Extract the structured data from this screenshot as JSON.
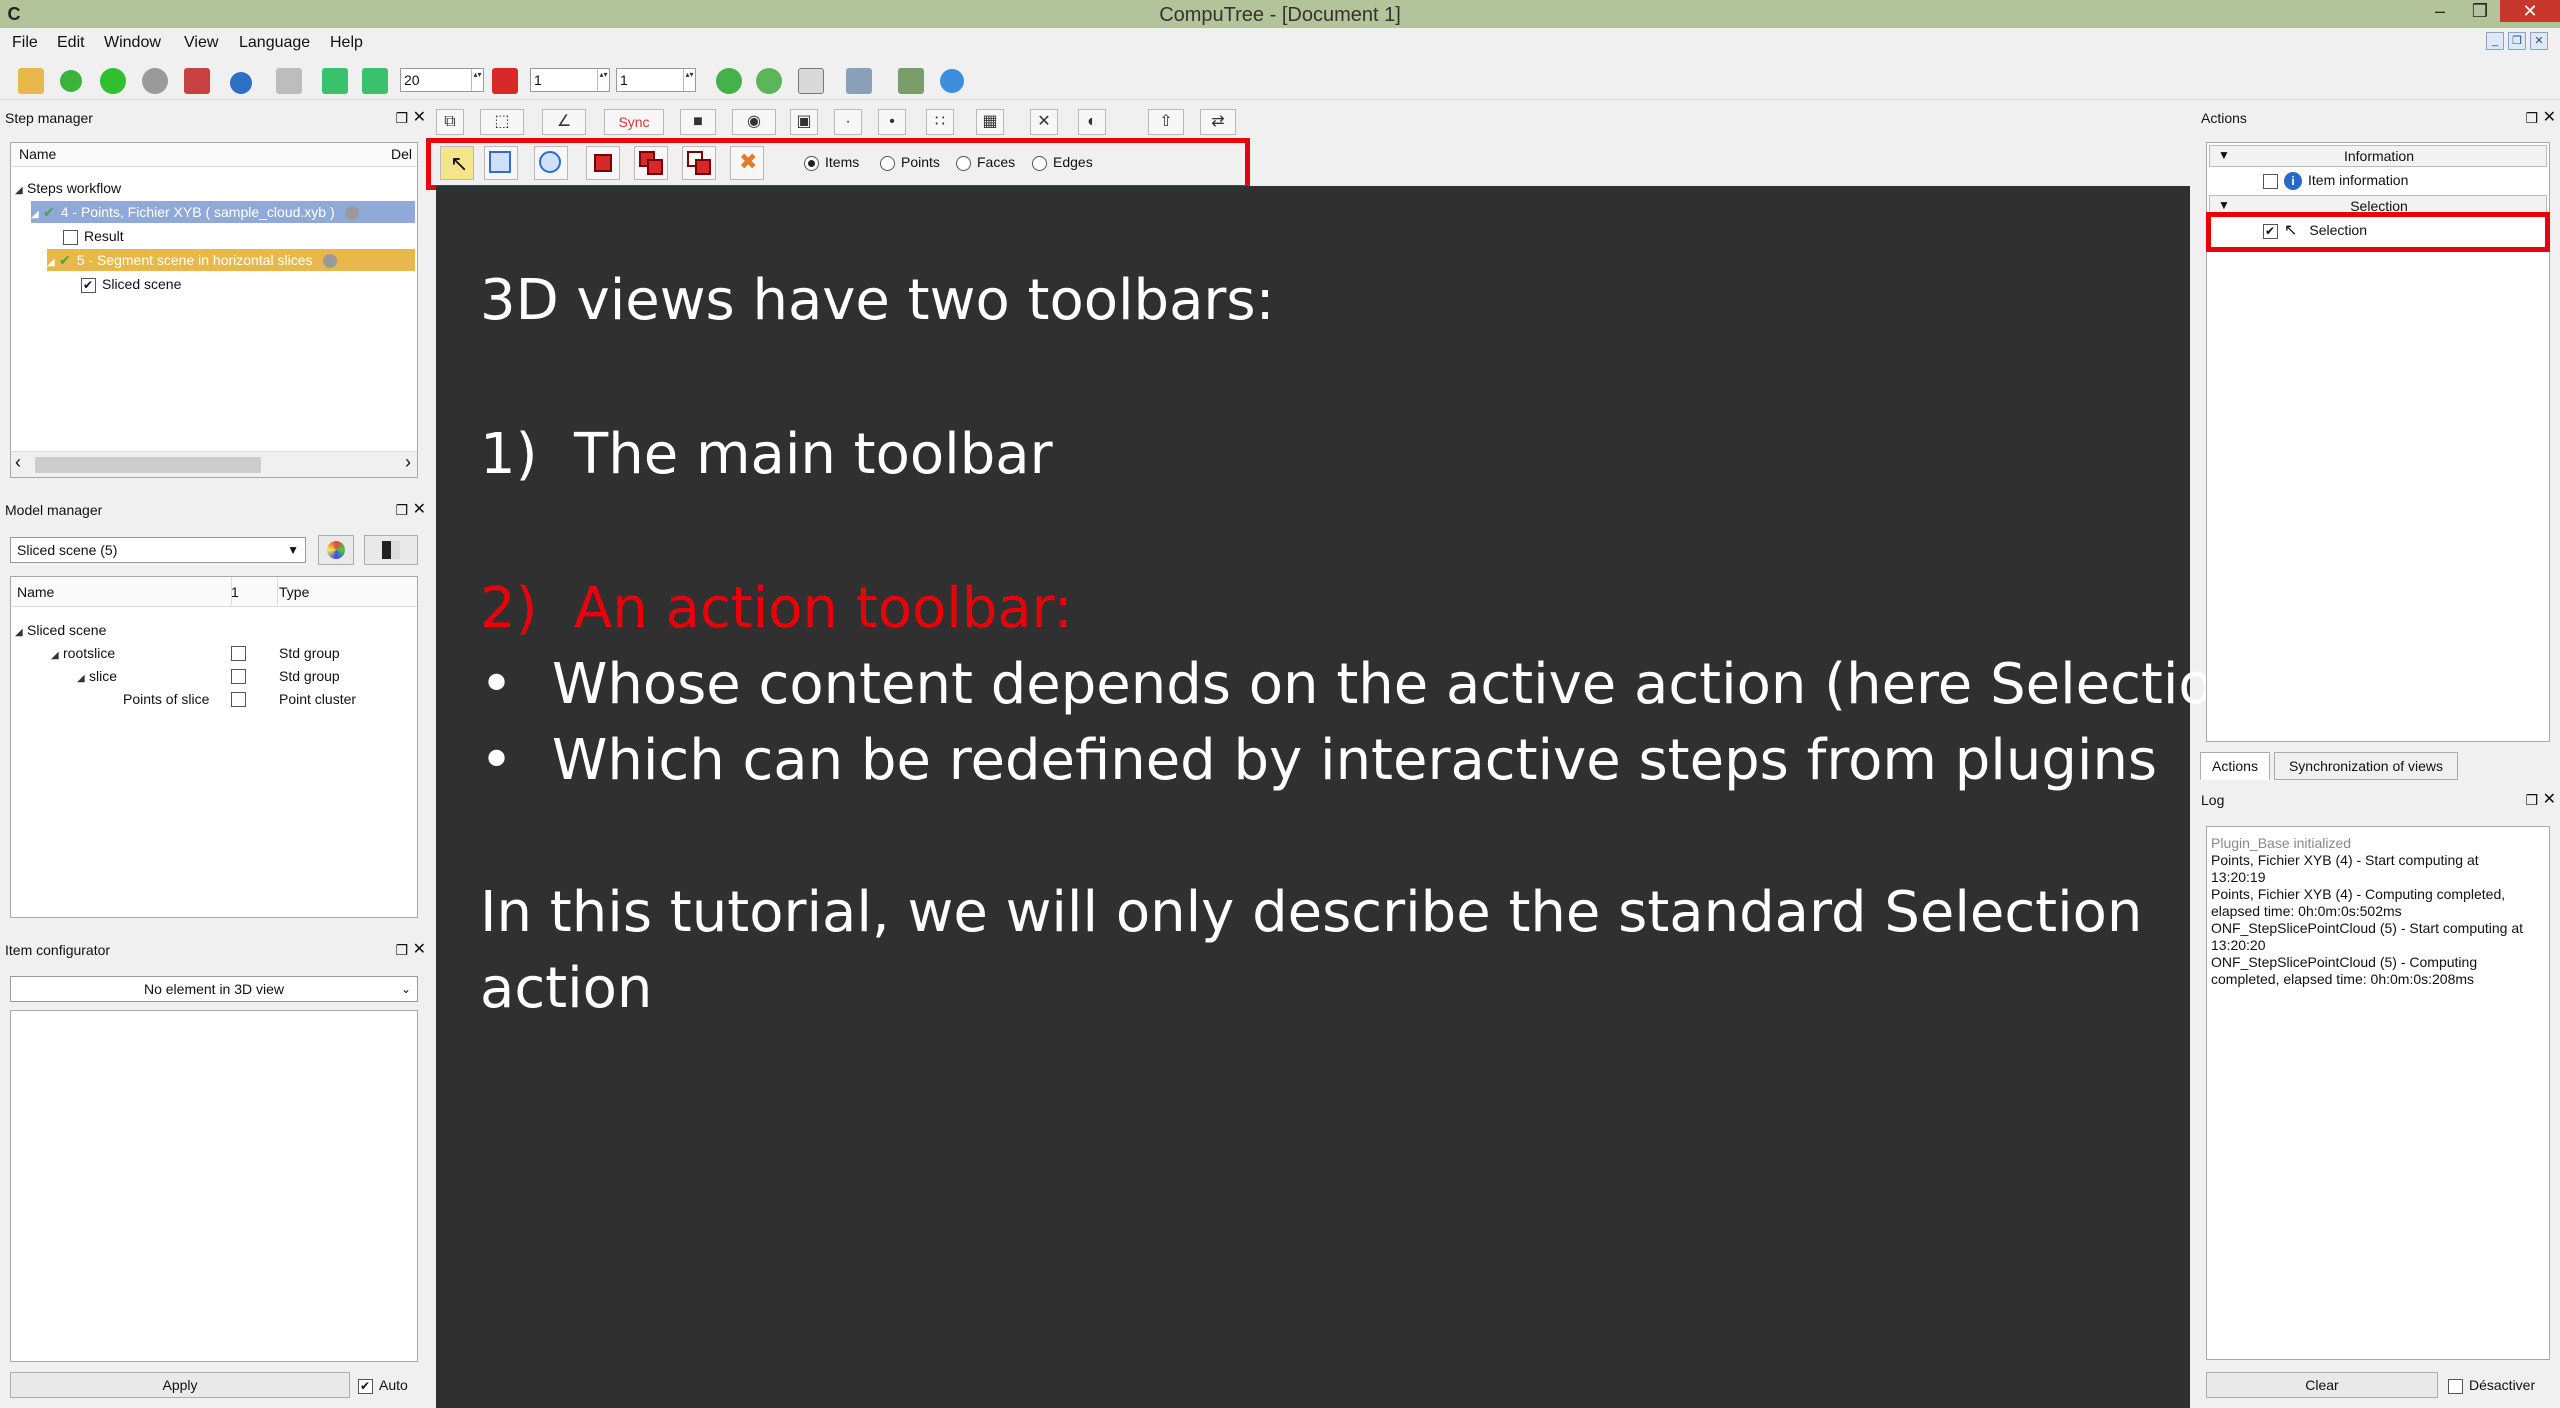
{
  "window": {
    "title": "CompuTree - [Document 1]",
    "logo_glyph": "C",
    "min_glyph": "–",
    "max_glyph": "❒",
    "close_glyph": "✕"
  },
  "menu": [
    "File",
    "Edit",
    "Window",
    "View",
    "Language",
    "Help"
  ],
  "mdi_controls": [
    "_",
    "❒",
    "✕"
  ],
  "main_toolbar": {
    "spin_speed": "20",
    "spin_start": "1",
    "spin_end": "1",
    "arrows": "▴▾"
  },
  "step_manager": {
    "title": "Step manager",
    "columns": [
      "Name",
      "Del"
    ],
    "rows": [
      {
        "label": "Steps workflow"
      },
      {
        "label": "4 - Points, Fichier XYB ( sample_cloud.xyb )"
      },
      {
        "label": "Result"
      },
      {
        "label": "5 - Segment scene in horizontal slices"
      },
      {
        "label": "Sliced scene"
      }
    ],
    "scroll_left": "‹",
    "scroll_right": "›"
  },
  "model_manager": {
    "title": "Model manager",
    "selected": "Sliced scene (5)",
    "columns": [
      "Name",
      "1",
      "Type"
    ],
    "rows": [
      {
        "name": "Sliced scene",
        "type": ""
      },
      {
        "name": "rootslice",
        "type": "Std group"
      },
      {
        "name": "slice",
        "type": "Std group"
      },
      {
        "name": "Points of slice",
        "type": "Point cluster"
      }
    ]
  },
  "item_configurator": {
    "title": "Item configurator",
    "selected": "No element in 3D view",
    "apply_label": "Apply",
    "auto_label": "Auto"
  },
  "view_toolbar": {
    "sync_label": "Sync",
    "buttons": [
      "⧉",
      "⬚",
      "∠",
      "■",
      "◉",
      "▣",
      "·",
      "•",
      "∷",
      "▦",
      "✕",
      "◐",
      "⇧",
      "⇄"
    ]
  },
  "action_toolbar": {
    "radios": [
      {
        "label": "Items",
        "checked": true
      },
      {
        "label": "Points",
        "checked": false
      },
      {
        "label": "Faces",
        "checked": false
      },
      {
        "label": "Edges",
        "checked": false
      }
    ]
  },
  "slide": {
    "line1": "3D views have two toolbars:",
    "item1_num": "1)",
    "item1_text": "The main toolbar",
    "item2_num": "2)",
    "item2_text": "An action toolbar:",
    "bullet": "•",
    "bullet1": "Whose content depends on the active action (here Selection)",
    "bullet2": "Which can be redefined by interactive steps from plugins",
    "closing1": "In this tutorial, we will only describe the standard Selection",
    "closing2": "action"
  },
  "actions_panel": {
    "title": "Actions",
    "groups": [
      {
        "label": "Information",
        "items": [
          {
            "label": "Item information",
            "checked": false
          }
        ]
      },
      {
        "label": "Selection",
        "items": [
          {
            "label": "Selection",
            "checked": true
          }
        ]
      }
    ],
    "tabs": [
      "Actions",
      "Synchronization of views"
    ]
  },
  "log_panel": {
    "title": "Log",
    "lines": [
      "Plugin_Base initialized",
      "Points, Fichier XYB (4) - Start computing at",
      "13:20:19",
      "Points, Fichier XYB (4) - Computing completed,",
      "elapsed time: 0h:0m:0s:502ms",
      "ONF_StepSlicePointCloud (5) - Start computing at",
      "13:20:20",
      "ONF_StepSlicePointCloud (5) - Computing",
      "completed, elapsed time: 0h:0m:0s:208ms"
    ],
    "clear_label": "Clear",
    "disable_label": "Désactiver"
  },
  "colors": {
    "title_bar": "#b4c49a",
    "highlight_red": "#e8000b",
    "view_background": "#303030",
    "step_selected": "#8fa9d8",
    "step_running": "#e8b84a"
  }
}
